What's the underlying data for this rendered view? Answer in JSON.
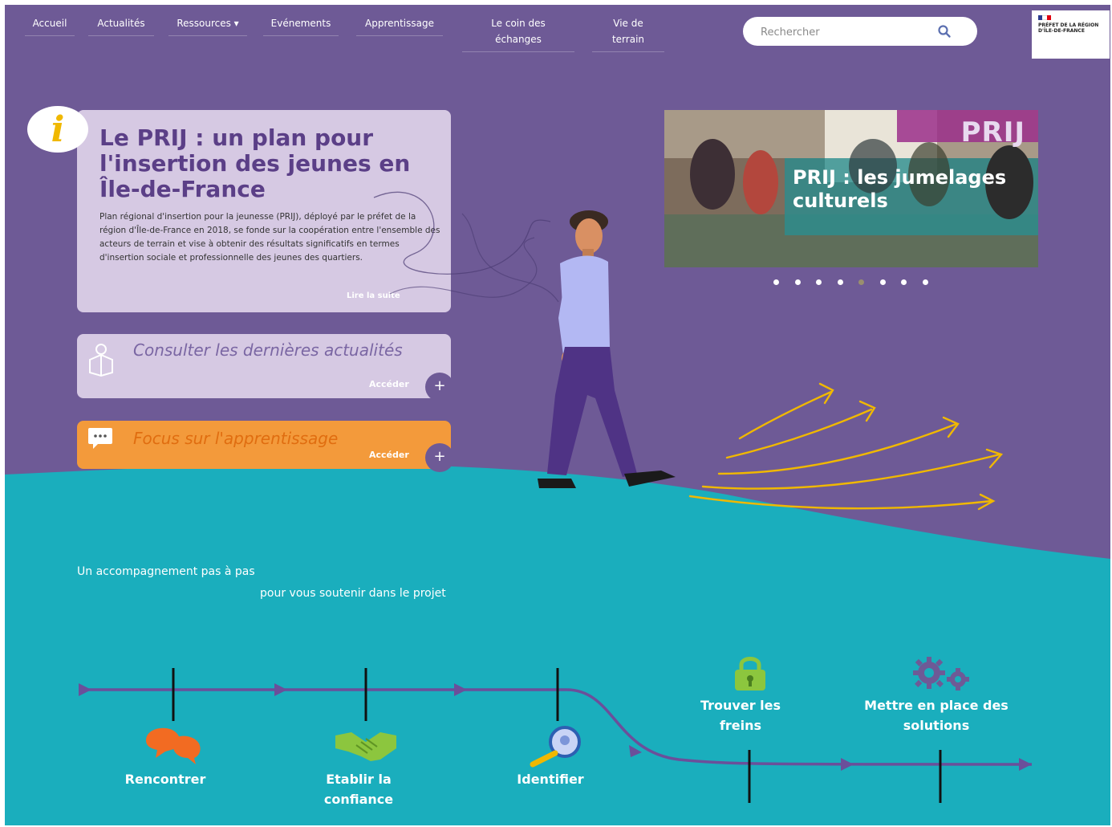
{
  "nav": {
    "items": [
      "Accueil",
      "Actualités",
      "Ressources ▾",
      "Evénements",
      "Apprentissage",
      "Le coin des échanges",
      "Vie de terrain"
    ]
  },
  "search": {
    "placeholder": "Rechercher"
  },
  "logo": {
    "text": "PRÉFET DE LA RÉGION D'ÎLE-DE-FRANCE",
    "icon": "republique-francaise-logo"
  },
  "info_card": {
    "icon": "info-icon",
    "title": "Le PRIJ : un plan pour l'insertion des jeunes en Île-de-France",
    "text": "Plan régional d'insertion pour la jeunesse (PRIJ), déployé par le préfet de la région d'Île-de-France en 2018, se fonde sur la coopération entre l'ensemble des acteurs de terrain et vise à obtenir des résultats significatifs en termes d'insertion sociale et professionnelle des jeunes des quartiers.",
    "read_more": "Lire la suite"
  },
  "actualites_card": {
    "icon": "news-icon",
    "label": "Consulter les dernières actualités",
    "access": "Accéder"
  },
  "focus_card": {
    "icon": "chat-icon",
    "label": "Focus sur l'apprentissage",
    "access": "Accéder"
  },
  "carousel": {
    "tag": "PRIJ",
    "slide_title": "PRIJ : les jumelages culturels",
    "dot_count": 8,
    "active_dot": 4
  },
  "tagline": {
    "line1": "Un accompagnement pas à pas",
    "line2": "pour vous soutenir dans le projet"
  },
  "steps": [
    {
      "label": "Rencontrer",
      "icon": "speech-bubbles-icon"
    },
    {
      "label": "Etablir la confiance",
      "icon": "handshake-icon"
    },
    {
      "label": "Identifier",
      "icon": "magnifier-icon"
    },
    {
      "label": "Trouver les freins",
      "icon": "padlock-icon"
    },
    {
      "label": "Mettre en place des solutions",
      "icon": "gears-icon"
    }
  ],
  "colors": {
    "purple": "#6e5a96",
    "teal": "#1aaebd",
    "card": "#d6c9e3",
    "orange": "#f39a3b",
    "yellow": "#f0b800",
    "green": "#8cc63e"
  }
}
